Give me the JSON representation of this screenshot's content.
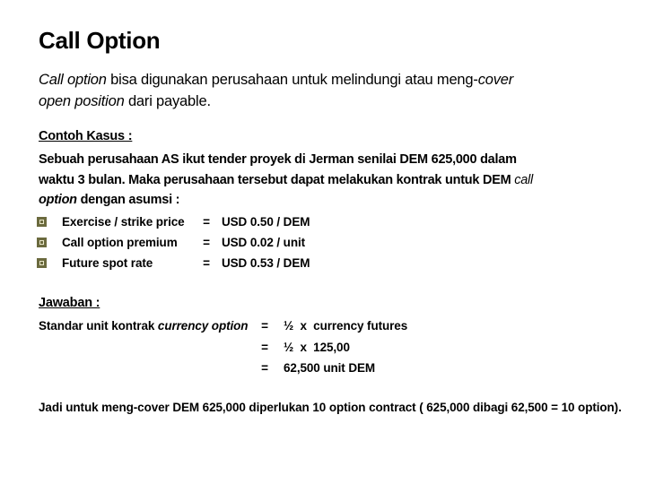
{
  "slide": {
    "title": "Call Option",
    "intro": {
      "term_italic": "Call option",
      "text_1": " bisa digunakan perusahaan untuk melindungi atau meng-",
      "cover_italic": "cover",
      "open_position_italic": "open position",
      "text_2": " dari payable."
    },
    "case": {
      "heading": "Contoh Kasus :",
      "line_1": "Sebuah perusahaan AS ikut tender proyek di Jerman senilai DEM 625,000 dalam",
      "line_2_text": "waktu 3 bulan. Maka perusahaan tersebut dapat melakukan kontrak untuk DEM ",
      "line_2_italic": "call",
      "line_3_italic": "option",
      "line_3_text": " dengan asumsi :",
      "assumptions": [
        {
          "icon": "square-bullet-icon",
          "label": "Exercise / strike price",
          "eq": "=",
          "value": "USD 0.50 / DEM"
        },
        {
          "icon": "square-bullet-icon",
          "label": "Call option premium",
          "eq": "=",
          "value": "USD 0.02 / unit"
        },
        {
          "icon": "square-bullet-icon",
          "label": "Future spot rate",
          "eq": "=",
          "value": "USD 0.53 / DEM"
        }
      ]
    },
    "answer": {
      "heading": "Jawaban :",
      "label_text": "Standar unit kontrak ",
      "label_italic": "currency option",
      "rows": [
        {
          "eq": "=",
          "value": "½  x  currency futures"
        },
        {
          "eq": "=",
          "value": "½  x  125,00"
        },
        {
          "eq": "=",
          "value": "62,500 unit DEM"
        }
      ]
    },
    "conclusion": "Jadi untuk meng-cover DEM 625,000 diperlukan 10 option contract ( 625,000 dibagi 62,500 = 10 option)."
  },
  "colors": {
    "bullet": "#6b6a3e",
    "bullet_inner": "#e8e6c8",
    "text": "#000000",
    "background": "#ffffff"
  }
}
